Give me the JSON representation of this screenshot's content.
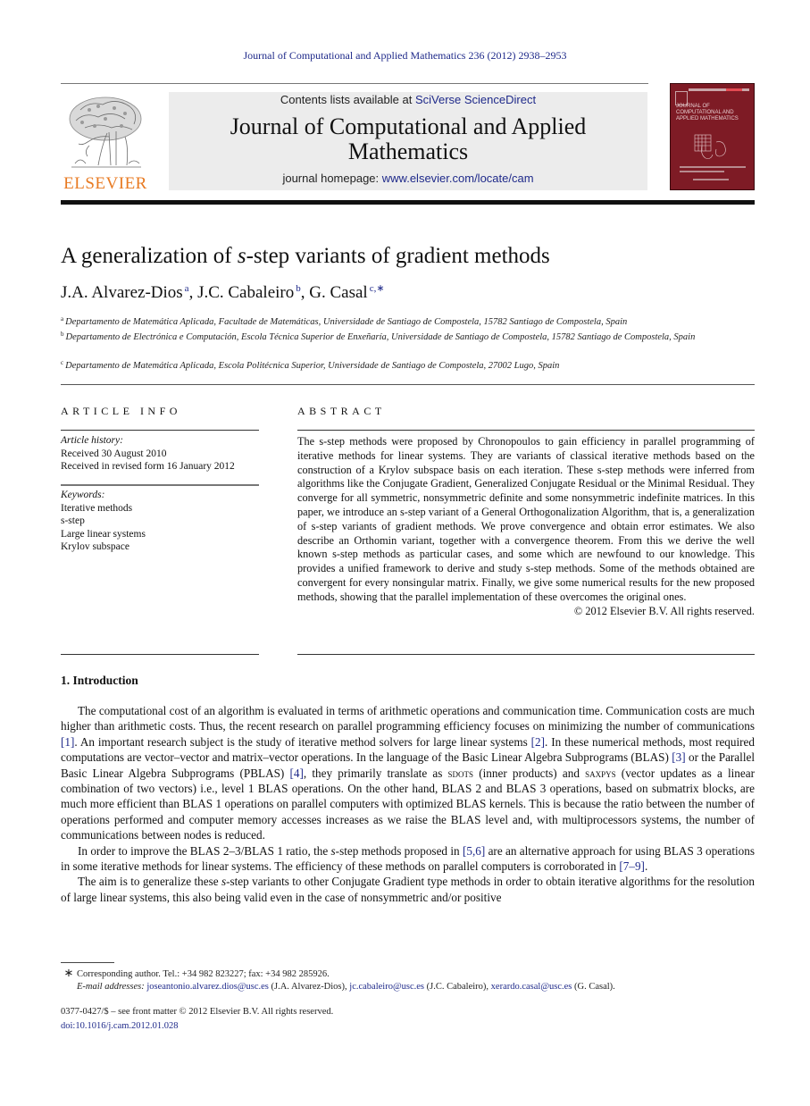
{
  "running_head": "Journal of Computational and Applied Mathematics 236 (2012) 2938–2953",
  "masthead": {
    "publisher_logo_text": "ELSEVIER",
    "contents_prefix": "Contents lists available at ",
    "contents_link": "SciVerse ScienceDirect",
    "journal_title_line1": "Journal of Computational and Applied",
    "journal_title_line2": "Mathematics",
    "homepage_prefix": "journal homepage: ",
    "homepage_link": "www.elsevier.com/locate/cam",
    "cover_title": "JOURNAL OF COMPUTATIONAL AND APPLIED MATHEMATICS"
  },
  "article": {
    "title_pre": "A generalization of ",
    "title_italic": "s",
    "title_post": "-step variants of gradient methods",
    "authors": [
      {
        "name": "J.A. Alvarez-Dios",
        "sup": "a",
        "sep": ", "
      },
      {
        "name": "J.C. Cabaleiro",
        "sup": "b",
        "sep": ", "
      },
      {
        "name": "G. Casal",
        "sup": "c,∗",
        "sep": ""
      }
    ],
    "affiliations": [
      {
        "mark": "a",
        "text": "Departamento de Matemática Aplicada, Facultade de Matemáticas, Universidade de Santiago de Compostela, 15782 Santiago de Compostela, Spain"
      },
      {
        "mark": "b",
        "text": "Departamento de Electrónica e Computación, Escola Técnica Superior de Enxeñaría, Universidade de Santiago de Compostela, 15782 Santiago de Compostela, Spain"
      },
      {
        "mark": "c",
        "text": "Departamento de Matemática Aplicada, Escola Politécnica Superior, Universidade de Santiago de Compostela, 27002 Lugo, Spain"
      }
    ]
  },
  "article_info": {
    "heading": "ARTICLE INFO",
    "history_label": "Article history:",
    "received": "Received 30 August 2010",
    "revised": "Received in revised form 16 January 2012",
    "keywords_label": "Keywords:",
    "keywords": [
      "Iterative methods",
      "s-step",
      "Large linear systems",
      "Krylov subspace"
    ]
  },
  "abstract": {
    "heading": "ABSTRACT",
    "text": "The s-step methods were proposed by Chronopoulos to gain efficiency in parallel programming of iterative methods for linear systems. They are variants of classical iterative methods based on the construction of a Krylov subspace basis on each iteration. These s-step methods were inferred from algorithms like the Conjugate Gradient, Generalized Conjugate Residual or the Minimal Residual. They converge for all symmetric, nonsymmetric definite and some nonsymmetric indefinite matrices. In this paper, we introduce an s-step variant of a General Orthogonalization Algorithm, that is, a generalization of s-step variants of gradient methods. We prove convergence and obtain error estimates. We also describe an Orthomin variant, together with a convergence theorem. From this we derive the well known s-step methods as particular cases, and some which are newfound to our knowledge. This provides a unified framework to derive and study s-step methods. Some of the methods obtained are convergent for every nonsingular matrix. Finally, we give some numerical results for the new proposed methods, showing that the parallel implementation of these overcomes the original ones.",
    "copyright": "© 2012 Elsevier B.V. All rights reserved."
  },
  "introduction": {
    "heading": "1.  Introduction",
    "p1": {
      "a": "The computational cost of an algorithm is evaluated in terms of arithmetic operations and communication time. Communication costs are much higher than arithmetic costs. Thus, the recent research on parallel programming efficiency focuses on minimizing the number of communications ",
      "ref1": "[1]",
      "b": ". An important research subject is the study of iterative method solvers for large linear systems ",
      "ref2": "[2]",
      "c": ". In these numerical methods, most required computations are vector–vector and matrix–vector operations. In the language of the Basic Linear Algebra Subprograms (BLAS) ",
      "ref3": "[3]",
      "d": " or the Parallel Basic Linear Algebra Subprograms (PBLAS) ",
      "ref4": "[4]",
      "e": ", they primarily translate as ",
      "sc1": "sdots",
      "f": " (inner products) and ",
      "sc2": "saxpys",
      "g": " (vector updates as a linear combination of two vectors) i.e., level 1 BLAS operations. On the other hand, BLAS 2 and BLAS 3 operations, based on submatrix blocks, are much more efficient than BLAS 1 operations on parallel computers with optimized BLAS kernels. This is because the ratio between the number of operations performed and computer memory accesses increases as we raise the BLAS level and, with multiprocessors systems, the number of communications between nodes is reduced."
    },
    "p2": {
      "a": "In order to improve the BLAS 2–3/BLAS 1 ratio, the ",
      "s": "s",
      "b": "-step methods proposed in ",
      "ref1": "[5,6]",
      "c": " are an alternative approach for using BLAS 3 operations in some iterative methods for linear systems. The efficiency of these methods on parallel computers is corroborated in ",
      "ref2": "[7–9]",
      "d": "."
    },
    "p3": {
      "a": "The aim is to generalize these ",
      "s": "s",
      "b": "-step variants to other Conjugate Gradient type methods in order to obtain iterative algorithms for the resolution of large linear systems, this also being valid even in the case of nonsymmetric and/or positive"
    }
  },
  "footnotes": {
    "star": "∗",
    "corresponding": "Corresponding author. Tel.: +34 982 823227; fax: +34 982 285926.",
    "email_label": "E-mail addresses:",
    "emails": [
      {
        "address": "joseantonio.alvarez.dios@usc.es",
        "owner": " (J.A. Alvarez-Dios), "
      },
      {
        "address": "jc.cabaleiro@usc.es",
        "owner": " (J.C. Cabaleiro), "
      },
      {
        "address": "xerardo.casal@usc.es",
        "owner": " (G. Casal)."
      }
    ]
  },
  "front_matter": {
    "issn_line": "0377-0427/$ – see front matter © 2012 Elsevier B.V. All rights reserved.",
    "doi": "doi:10.1016/j.cam.2012.01.028"
  },
  "colors": {
    "link": "#1f2a8a",
    "elsevier_orange": "#e87a22",
    "cover_red": "#7e1b25",
    "masthead_gray": "#ececec"
  }
}
